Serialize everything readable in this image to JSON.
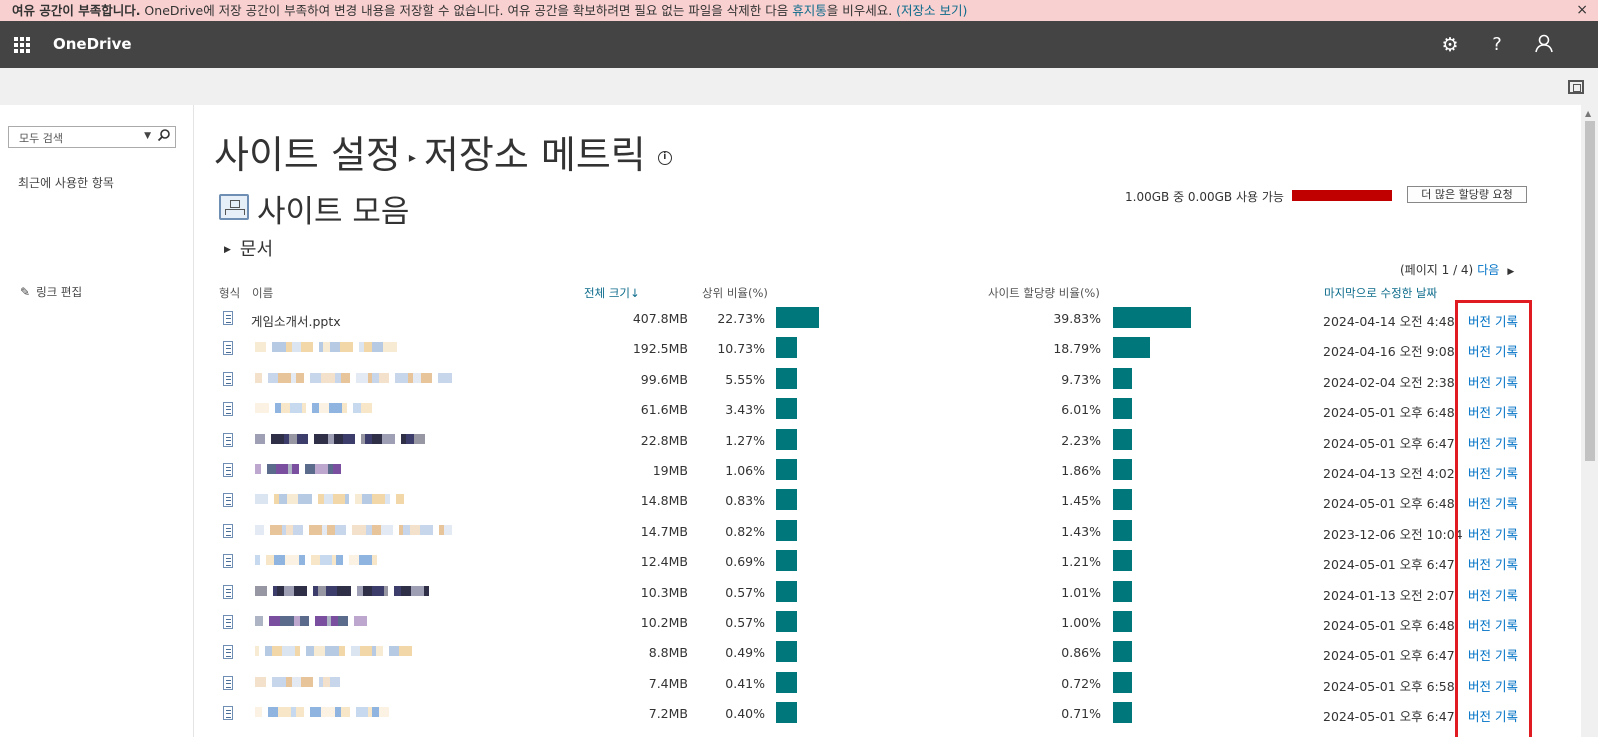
{
  "banner": {
    "bold": "여유 공간이 부족합니다.",
    "text1": " OneDrive에 저장 공간이 부족하여 변경 내용을 저장할 수 없습니다. 여유 공간을 확보하려면 필요 없는 파일을 삭제한 다음 ",
    "link1": "휴지통",
    "text2": "을 비우세요. ",
    "link2": "(저장소 보기)",
    "close": "×"
  },
  "suitebar": {
    "brand": "OneDrive",
    "settings_icon": "⚙",
    "help_icon": "?",
    "account_icon": "⚲"
  },
  "leftnav": {
    "search_placeholder": "모두 검색",
    "recent": "최근에 사용한 항목",
    "edit_links": "링크 편집"
  },
  "page": {
    "title_a": "사이트 설정",
    "title_sep": "▸",
    "title_b": "저장소 메트릭",
    "info_icon": "i",
    "collection": "사이트 모음",
    "docs": "문서",
    "quota_text": "1.00GB 중 0.00GB 사용 가능",
    "quota_button": "더 많은 할당량 요청",
    "paging": "(페이지 1 / 4)",
    "next": "다음"
  },
  "columns": {
    "type": "형식",
    "name": "이름",
    "size": "전체 크기↓",
    "parent_pct": "상위 비율(%)",
    "quota_pct": "사이트 할당량 비율(%)",
    "modified": "마지막으로 수정한 날짜"
  },
  "colors": {
    "bar": "#00777a",
    "quota_bar": "#c00000",
    "highlight": "#e01b22"
  },
  "rows": [
    {
      "name": "게임소개서.pptx",
      "size": "407.8MB",
      "parent_pct": "22.73%",
      "parent_val": 22.73,
      "quota_pct": "39.83%",
      "quota_val": 39.83,
      "modified": "2024-04-14 오전 4:48",
      "action": "버전 기록"
    },
    {
      "name": "",
      "size": "192.5MB",
      "parent_pct": "10.73%",
      "parent_val": 10.73,
      "quota_pct": "18.79%",
      "quota_val": 18.79,
      "modified": "2024-04-16 오전 9:08",
      "action": "버전 기록"
    },
    {
      "name": "",
      "size": "99.6MB",
      "parent_pct": "5.55%",
      "parent_val": 5.55,
      "quota_pct": "9.73%",
      "quota_val": 9.73,
      "modified": "2024-02-04 오전 2:38",
      "action": "버전 기록"
    },
    {
      "name": "",
      "size": "61.6MB",
      "parent_pct": "3.43%",
      "parent_val": 3.43,
      "quota_pct": "6.01%",
      "quota_val": 6.01,
      "modified": "2024-05-01 오후 6:48",
      "action": "버전 기록"
    },
    {
      "name": "",
      "size": "22.8MB",
      "parent_pct": "1.27%",
      "parent_val": 1.27,
      "quota_pct": "2.23%",
      "quota_val": 2.23,
      "modified": "2024-05-01 오후 6:47",
      "action": "버전 기록"
    },
    {
      "name": "",
      "size": "19MB",
      "parent_pct": "1.06%",
      "parent_val": 1.06,
      "quota_pct": "1.86%",
      "quota_val": 1.86,
      "modified": "2024-04-13 오전 4:02",
      "action": "버전 기록"
    },
    {
      "name": "",
      "size": "14.8MB",
      "parent_pct": "0.83%",
      "parent_val": 0.83,
      "quota_pct": "1.45%",
      "quota_val": 1.45,
      "modified": "2024-05-01 오후 6:48",
      "action": "버전 기록"
    },
    {
      "name": "",
      "size": "14.7MB",
      "parent_pct": "0.82%",
      "parent_val": 0.82,
      "quota_pct": "1.43%",
      "quota_val": 1.43,
      "modified": "2023-12-06 오전 10:04",
      "action": "버전 기록"
    },
    {
      "name": "",
      "size": "12.4MB",
      "parent_pct": "0.69%",
      "parent_val": 0.69,
      "quota_pct": "1.21%",
      "quota_val": 1.21,
      "modified": "2024-05-01 오후 6:47",
      "action": "버전 기록"
    },
    {
      "name": "",
      "size": "10.3MB",
      "parent_pct": "0.57%",
      "parent_val": 0.57,
      "quota_pct": "1.01%",
      "quota_val": 1.01,
      "modified": "2024-01-13 오전 2:07",
      "action": "버전 기록"
    },
    {
      "name": "",
      "size": "10.2MB",
      "parent_pct": "0.57%",
      "parent_val": 0.57,
      "quota_pct": "1.00%",
      "quota_val": 1.0,
      "modified": "2024-05-01 오후 6:48",
      "action": "버전 기록"
    },
    {
      "name": "",
      "size": "8.8MB",
      "parent_pct": "0.49%",
      "parent_val": 0.49,
      "quota_pct": "0.86%",
      "quota_val": 0.86,
      "modified": "2024-05-01 오후 6:47",
      "action": "버전 기록"
    },
    {
      "name": "",
      "size": "7.4MB",
      "parent_pct": "0.41%",
      "parent_val": 0.41,
      "quota_pct": "0.72%",
      "quota_val": 0.72,
      "modified": "2024-05-01 오후 6:58",
      "action": "버전 기록"
    },
    {
      "name": "",
      "size": "7.2MB",
      "parent_pct": "0.40%",
      "parent_val": 0.4,
      "quota_pct": "0.71%",
      "quota_val": 0.71,
      "modified": "2024-05-01 오후 6:47",
      "action": "버전 기록"
    }
  ]
}
